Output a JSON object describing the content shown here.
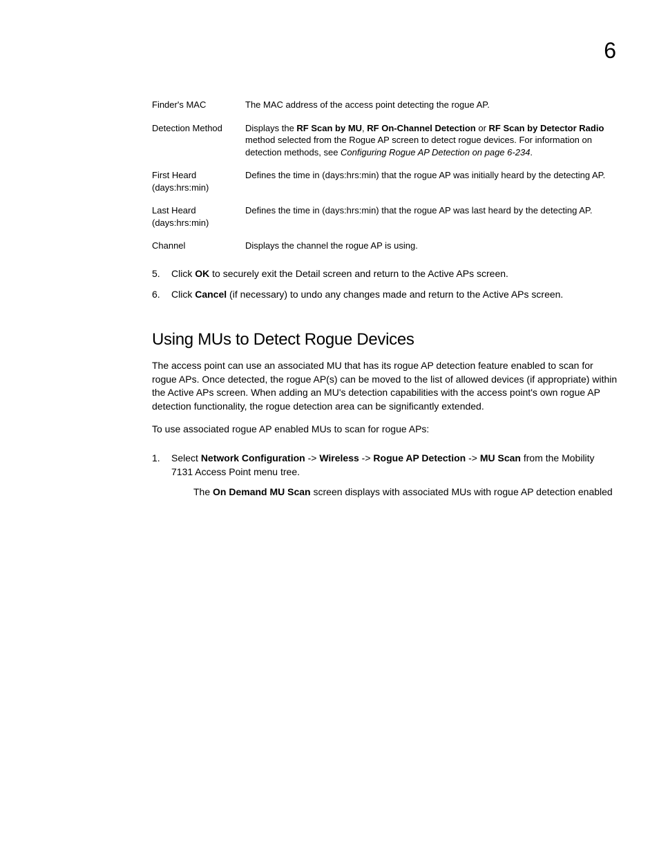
{
  "chapter_number": "6",
  "definitions": [
    {
      "term": "Finder's MAC",
      "desc": "The MAC address of the access point detecting the rogue AP."
    },
    {
      "term": "Detection Method",
      "desc_parts": [
        {
          "t": "Displays the ",
          "b": false
        },
        {
          "t": "RF Scan by MU",
          "b": true
        },
        {
          "t": ", ",
          "b": false
        },
        {
          "t": "RF On-Channel Detection",
          "b": true
        },
        {
          "t": " or ",
          "b": false
        },
        {
          "t": "RF Scan by Detector Radio",
          "b": true
        },
        {
          "t": " method selected from the Rogue AP screen to detect rogue devices. For information on detection methods, see ",
          "b": false
        },
        {
          "t": "Configuring Rogue AP Detection on page 6-234",
          "i": true
        },
        {
          "t": ".",
          "b": false
        }
      ]
    },
    {
      "term": "First Heard (days:hrs:min)",
      "desc": "Defines the time in (days:hrs:min) that the rogue AP was initially heard by the detecting AP."
    },
    {
      "term": "Last Heard (days:hrs:min)",
      "desc": "Defines the time in (days:hrs:min) that the rogue AP was last heard by the detecting AP."
    },
    {
      "term": "Channel",
      "desc": "Displays the channel the rogue AP is using."
    }
  ],
  "first_steps": [
    {
      "num": "5.",
      "parts": [
        {
          "t": "Click "
        },
        {
          "t": "OK",
          "b": true
        },
        {
          "t": " to securely exit the Detail screen and return to the Active APs screen."
        }
      ]
    },
    {
      "num": "6.",
      "parts": [
        {
          "t": "Click "
        },
        {
          "t": "Cancel",
          "b": true
        },
        {
          "t": " (if necessary) to undo any changes made and return to the Active APs screen."
        }
      ]
    }
  ],
  "section_heading": "Using MUs to Detect Rogue Devices",
  "para1": "The access point can use an associated MU that has its rogue AP detection feature enabled to scan for rogue APs. Once detected, the rogue AP(s) can be moved to the list of allowed devices (if appropriate) within the Active APs screen. When adding an MU's detection capabilities with the access point's own rogue AP detection functionality, the rogue detection area can be significantly extended.",
  "para2": "To use associated rogue AP enabled MUs to scan for rogue APs:",
  "second_steps": [
    {
      "num": "1.",
      "parts": [
        {
          "t": "Select "
        },
        {
          "t": "Network Configuration",
          "b": true
        },
        {
          "t": " -> "
        },
        {
          "t": "Wireless",
          "b": true
        },
        {
          "t": " -> "
        },
        {
          "t": "Rogue AP Detection",
          "b": true
        },
        {
          "t": " -> "
        },
        {
          "t": "MU Scan",
          "b": true
        },
        {
          "t": " from the Mobility 7131 Access Point menu tree."
        }
      ],
      "sub_parts": [
        {
          "t": "The "
        },
        {
          "t": "On Demand MU Scan",
          "b": true
        },
        {
          "t": " screen displays with associated MUs with rogue AP detection enabled"
        }
      ]
    }
  ]
}
